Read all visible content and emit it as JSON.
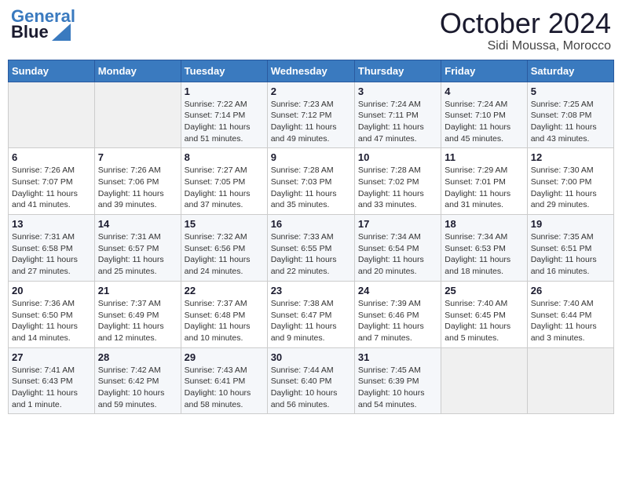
{
  "header": {
    "logo_line1": "General",
    "logo_line2": "Blue",
    "month": "October 2024",
    "location": "Sidi Moussa, Morocco"
  },
  "weekdays": [
    "Sunday",
    "Monday",
    "Tuesday",
    "Wednesday",
    "Thursday",
    "Friday",
    "Saturday"
  ],
  "weeks": [
    [
      {
        "day": "",
        "info": ""
      },
      {
        "day": "",
        "info": ""
      },
      {
        "day": "1",
        "info": "Sunrise: 7:22 AM\nSunset: 7:14 PM\nDaylight: 11 hours and 51 minutes."
      },
      {
        "day": "2",
        "info": "Sunrise: 7:23 AM\nSunset: 7:12 PM\nDaylight: 11 hours and 49 minutes."
      },
      {
        "day": "3",
        "info": "Sunrise: 7:24 AM\nSunset: 7:11 PM\nDaylight: 11 hours and 47 minutes."
      },
      {
        "day": "4",
        "info": "Sunrise: 7:24 AM\nSunset: 7:10 PM\nDaylight: 11 hours and 45 minutes."
      },
      {
        "day": "5",
        "info": "Sunrise: 7:25 AM\nSunset: 7:08 PM\nDaylight: 11 hours and 43 minutes."
      }
    ],
    [
      {
        "day": "6",
        "info": "Sunrise: 7:26 AM\nSunset: 7:07 PM\nDaylight: 11 hours and 41 minutes."
      },
      {
        "day": "7",
        "info": "Sunrise: 7:26 AM\nSunset: 7:06 PM\nDaylight: 11 hours and 39 minutes."
      },
      {
        "day": "8",
        "info": "Sunrise: 7:27 AM\nSunset: 7:05 PM\nDaylight: 11 hours and 37 minutes."
      },
      {
        "day": "9",
        "info": "Sunrise: 7:28 AM\nSunset: 7:03 PM\nDaylight: 11 hours and 35 minutes."
      },
      {
        "day": "10",
        "info": "Sunrise: 7:28 AM\nSunset: 7:02 PM\nDaylight: 11 hours and 33 minutes."
      },
      {
        "day": "11",
        "info": "Sunrise: 7:29 AM\nSunset: 7:01 PM\nDaylight: 11 hours and 31 minutes."
      },
      {
        "day": "12",
        "info": "Sunrise: 7:30 AM\nSunset: 7:00 PM\nDaylight: 11 hours and 29 minutes."
      }
    ],
    [
      {
        "day": "13",
        "info": "Sunrise: 7:31 AM\nSunset: 6:58 PM\nDaylight: 11 hours and 27 minutes."
      },
      {
        "day": "14",
        "info": "Sunrise: 7:31 AM\nSunset: 6:57 PM\nDaylight: 11 hours and 25 minutes."
      },
      {
        "day": "15",
        "info": "Sunrise: 7:32 AM\nSunset: 6:56 PM\nDaylight: 11 hours and 24 minutes."
      },
      {
        "day": "16",
        "info": "Sunrise: 7:33 AM\nSunset: 6:55 PM\nDaylight: 11 hours and 22 minutes."
      },
      {
        "day": "17",
        "info": "Sunrise: 7:34 AM\nSunset: 6:54 PM\nDaylight: 11 hours and 20 minutes."
      },
      {
        "day": "18",
        "info": "Sunrise: 7:34 AM\nSunset: 6:53 PM\nDaylight: 11 hours and 18 minutes."
      },
      {
        "day": "19",
        "info": "Sunrise: 7:35 AM\nSunset: 6:51 PM\nDaylight: 11 hours and 16 minutes."
      }
    ],
    [
      {
        "day": "20",
        "info": "Sunrise: 7:36 AM\nSunset: 6:50 PM\nDaylight: 11 hours and 14 minutes."
      },
      {
        "day": "21",
        "info": "Sunrise: 7:37 AM\nSunset: 6:49 PM\nDaylight: 11 hours and 12 minutes."
      },
      {
        "day": "22",
        "info": "Sunrise: 7:37 AM\nSunset: 6:48 PM\nDaylight: 11 hours and 10 minutes."
      },
      {
        "day": "23",
        "info": "Sunrise: 7:38 AM\nSunset: 6:47 PM\nDaylight: 11 hours and 9 minutes."
      },
      {
        "day": "24",
        "info": "Sunrise: 7:39 AM\nSunset: 6:46 PM\nDaylight: 11 hours and 7 minutes."
      },
      {
        "day": "25",
        "info": "Sunrise: 7:40 AM\nSunset: 6:45 PM\nDaylight: 11 hours and 5 minutes."
      },
      {
        "day": "26",
        "info": "Sunrise: 7:40 AM\nSunset: 6:44 PM\nDaylight: 11 hours and 3 minutes."
      }
    ],
    [
      {
        "day": "27",
        "info": "Sunrise: 7:41 AM\nSunset: 6:43 PM\nDaylight: 11 hours and 1 minute."
      },
      {
        "day": "28",
        "info": "Sunrise: 7:42 AM\nSunset: 6:42 PM\nDaylight: 10 hours and 59 minutes."
      },
      {
        "day": "29",
        "info": "Sunrise: 7:43 AM\nSunset: 6:41 PM\nDaylight: 10 hours and 58 minutes."
      },
      {
        "day": "30",
        "info": "Sunrise: 7:44 AM\nSunset: 6:40 PM\nDaylight: 10 hours and 56 minutes."
      },
      {
        "day": "31",
        "info": "Sunrise: 7:45 AM\nSunset: 6:39 PM\nDaylight: 10 hours and 54 minutes."
      },
      {
        "day": "",
        "info": ""
      },
      {
        "day": "",
        "info": ""
      }
    ]
  ]
}
